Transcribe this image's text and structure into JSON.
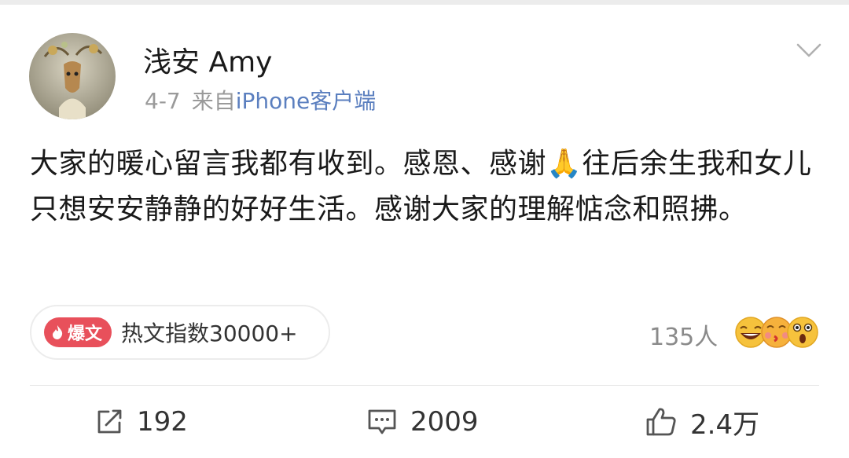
{
  "post": {
    "username": "浅安 Amy",
    "date": "4-7",
    "source_prefix": "来自",
    "source_name": "iPhone客户端",
    "content": "大家的暖心留言我都有收到。感恩、感谢🙏往后余生我和女儿只想安安静静的好好生活。感谢大家的理解惦念和照拂。"
  },
  "hot": {
    "badge": "爆文",
    "index_text": "热文指数30000+"
  },
  "reactions": {
    "count": "135人",
    "emojis": [
      "laughing-face",
      "kissing-face",
      "surprised-face"
    ]
  },
  "actions": {
    "repost_count": "192",
    "comment_count": "2009",
    "like_count": "2.4万"
  },
  "colors": {
    "link_blue": "#5b7fbf",
    "badge_red": "#e8505b",
    "muted_gray": "#9a9a9a"
  }
}
